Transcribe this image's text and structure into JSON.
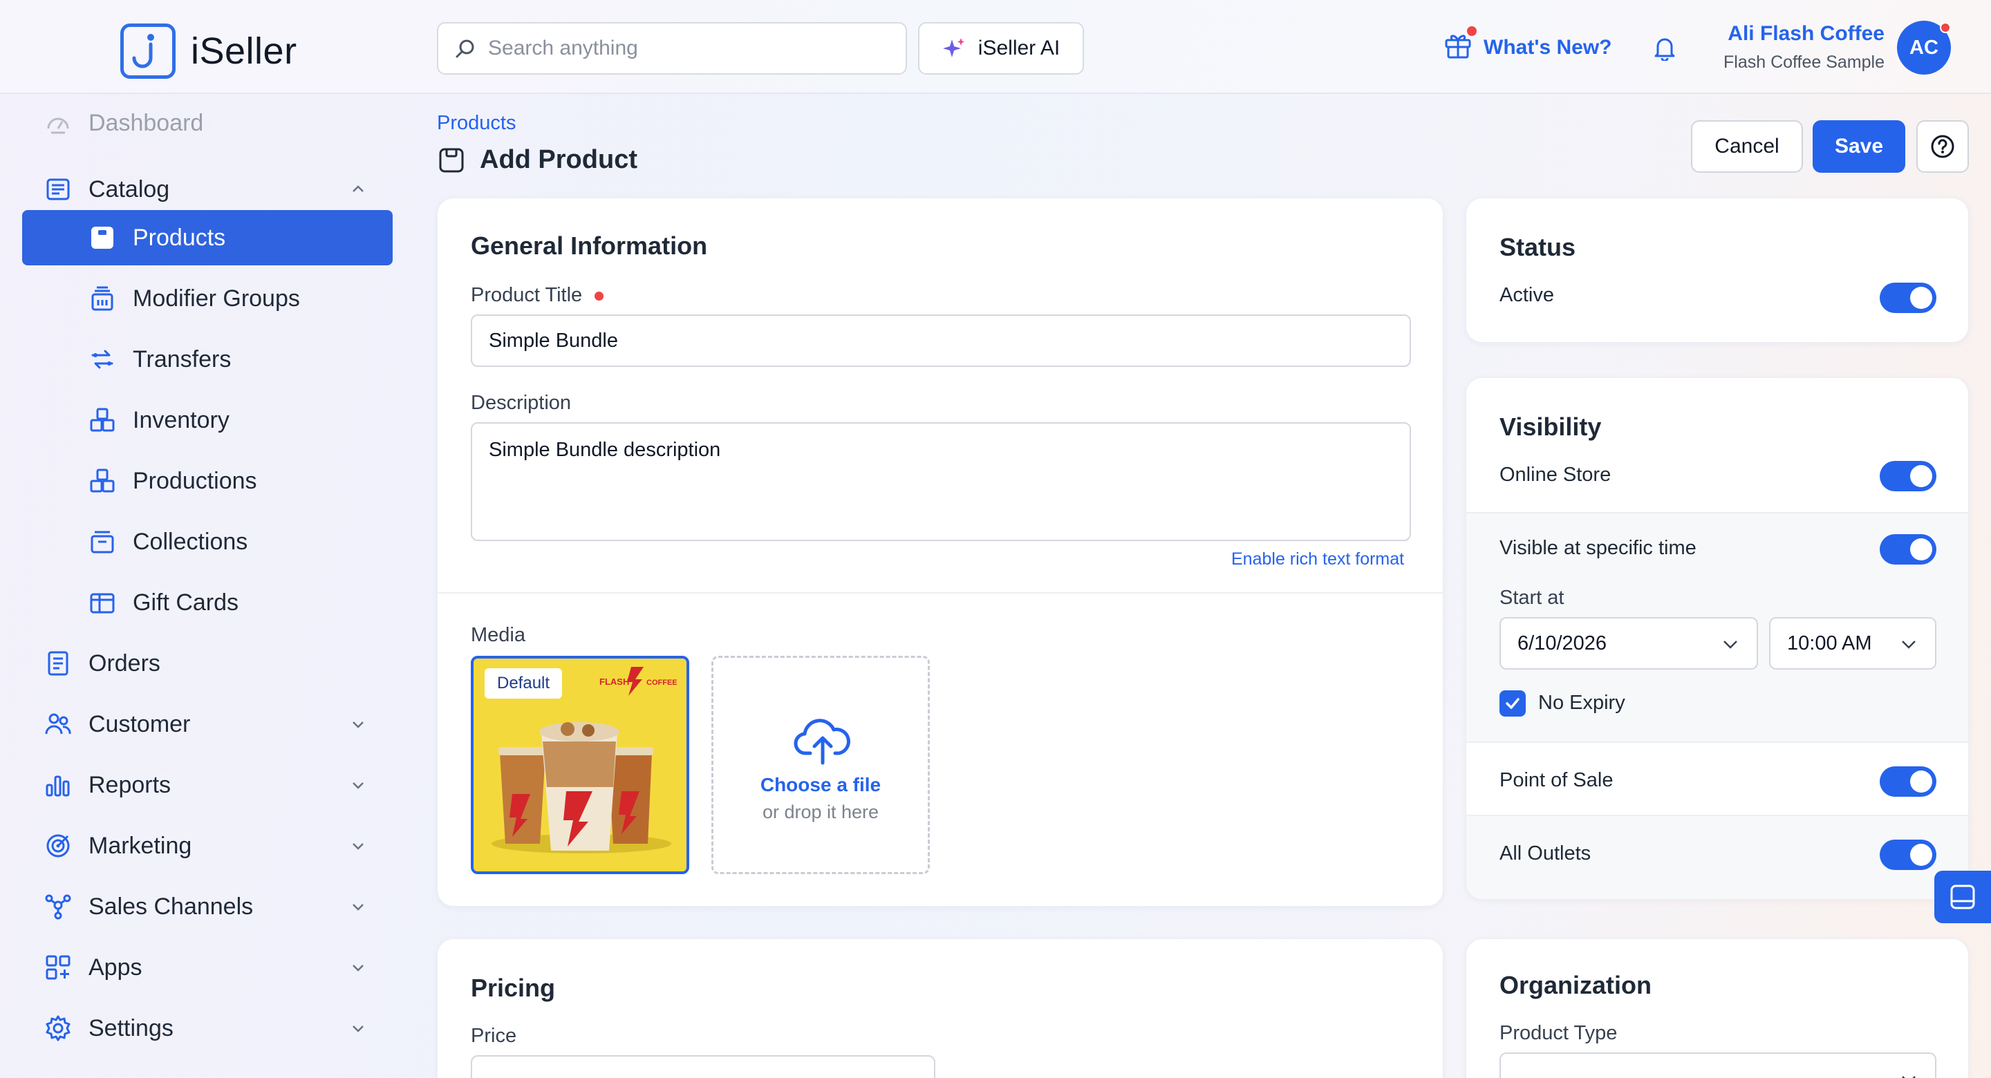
{
  "app": {
    "name": "iSeller"
  },
  "header": {
    "search_placeholder": "Search anything",
    "ai_label": "iSeller AI",
    "whats_new": "What's New?",
    "user_name": "Ali Flash Coffee",
    "user_store": "Flash Coffee Sample",
    "avatar_initials": "AC"
  },
  "sidebar": {
    "items": [
      {
        "label": "Dashboard",
        "icon": "dashboard-icon"
      },
      {
        "label": "Catalog",
        "icon": "catalog-icon",
        "expanded": true
      },
      {
        "label": "Products",
        "icon": "product-icon",
        "active": true
      },
      {
        "label": "Modifier Groups",
        "icon": "modifier-icon"
      },
      {
        "label": "Transfers",
        "icon": "transfer-icon"
      },
      {
        "label": "Inventory",
        "icon": "inventory-icon"
      },
      {
        "label": "Productions",
        "icon": "production-icon"
      },
      {
        "label": "Collections",
        "icon": "collection-icon"
      },
      {
        "label": "Gift Cards",
        "icon": "gift-card-icon"
      },
      {
        "label": "Orders",
        "icon": "orders-icon"
      },
      {
        "label": "Customer",
        "icon": "customer-icon"
      },
      {
        "label": "Reports",
        "icon": "reports-icon"
      },
      {
        "label": "Marketing",
        "icon": "marketing-icon"
      },
      {
        "label": "Sales Channels",
        "icon": "sales-channels-icon"
      },
      {
        "label": "Apps",
        "icon": "apps-icon"
      },
      {
        "label": "Settings",
        "icon": "settings-icon"
      }
    ]
  },
  "page": {
    "breadcrumb": "Products",
    "title": "Add Product",
    "cancel_label": "Cancel",
    "save_label": "Save"
  },
  "general": {
    "heading": "General Information",
    "title_label": "Product Title",
    "title_value": "Simple Bundle",
    "description_label": "Description",
    "description_value": "Simple Bundle description",
    "rich_text_link": "Enable rich text format",
    "media_label": "Media",
    "default_badge": "Default",
    "choose_file": "Choose a file",
    "drop_hint": "or drop it here"
  },
  "pricing": {
    "heading": "Pricing",
    "price_label": "Price"
  },
  "status": {
    "heading": "Status",
    "active_label": "Active",
    "active_on": true
  },
  "visibility": {
    "heading": "Visibility",
    "online_store": "Online Store",
    "visible_specific_time": "Visible at specific time",
    "start_at": "Start at",
    "start_date": "6/10/2026",
    "start_time": "10:00 AM",
    "no_expiry": "No Expiry",
    "point_of_sale": "Point of Sale",
    "all_outlets": "All Outlets"
  },
  "organization": {
    "heading": "Organization",
    "product_type_label": "Product Type"
  },
  "colors": {
    "accent": "#2563eb",
    "danger": "#ef4444"
  }
}
